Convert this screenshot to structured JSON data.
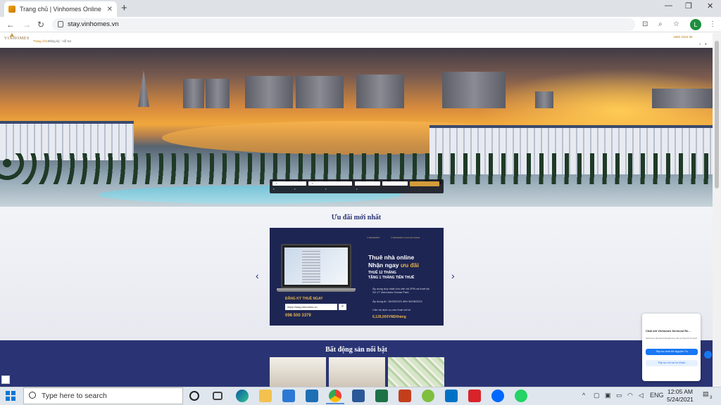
{
  "browser": {
    "tab_title": "Trang chủ | Vinhomes Online",
    "url": "stay.vinhomes.vn",
    "avatar_letter": "L"
  },
  "header": {
    "logo_text": "VINHOMES",
    "menu": [
      "Trang chủ",
      "Đăng ký - Hỗ trợ"
    ],
    "hotline": "1900 2323 89"
  },
  "offers": {
    "title": "Ưu đãi mới nhất",
    "banner": {
      "brand_left": "VINHOMES",
      "brand_right": "VINHOMES OCEAN PARK",
      "headline_1": "Thuê nhà online",
      "headline_2_prefix": "Nhận ngay ",
      "headline_2_accent": "ưu đãi",
      "promo_1": "THUÊ 12 THÁNG",
      "promo_2": "TẶNG 1 THÁNG TIỀN THUÊ",
      "detail_1": "Áp dụng duy nhất cho căn hộ 2PN và thuê tại S2.17 Vinhomes Ocean Park",
      "detail_2": "Áp dụng từ: 15/03/2021 đến 30/06/2021",
      "detail_3": "Căn hộ dịch vụ cho thuê chỉ từ",
      "price": "6,126,000VNĐ/tháng",
      "cta": "ĐĂNG KÝ THUÊ NGAY",
      "url_box": "https://stay.vinhomes.vn",
      "phone": "098 500 3379"
    }
  },
  "featured": {
    "title": "Bất động sản nổi bật"
  },
  "chat": {
    "title": "Chat với Vinhomes Serviced Re...",
    "message": "Vinhomes Serviced Residences rất vui lòng hỗ trợ bạn!",
    "btn_primary": "Tiếp tục dưới tên Nguyễn Thị",
    "btn_secondary": "Tiếp tục với vai trò khách"
  },
  "taskbar": {
    "search_placeholder": "Type here to search",
    "lang": "ENG",
    "time": "12:05 AM",
    "date": "5/24/2021",
    "notifications": "3"
  }
}
